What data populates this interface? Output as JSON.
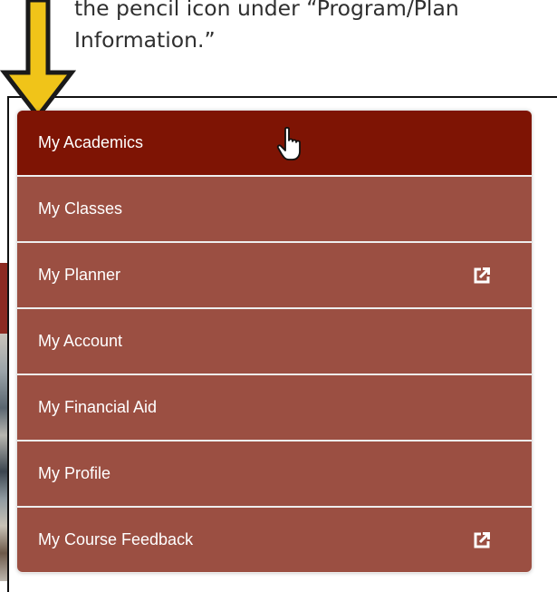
{
  "instruction": {
    "line1": "the pencil icon under “Program/Plan",
    "line2": "Information.”"
  },
  "colors": {
    "arrow_fill": "#f0c419",
    "menu_item": "#9b4f42",
    "menu_item_active": "#7e1404",
    "menu_text": "#ffffff"
  },
  "menu": {
    "items": [
      {
        "label": "My Academics",
        "active": true,
        "external_icon": "none"
      },
      {
        "label": "My Classes",
        "active": false,
        "external_icon": "none"
      },
      {
        "label": "My Planner",
        "active": false,
        "external_icon": "external-link-icon"
      },
      {
        "label": "My Account",
        "active": false,
        "external_icon": "none"
      },
      {
        "label": "My Financial Aid",
        "active": false,
        "external_icon": "none"
      },
      {
        "label": "My Profile",
        "active": false,
        "external_icon": "none"
      },
      {
        "label": "My Course Feedback",
        "active": false,
        "external_icon": "external-link-icon"
      }
    ]
  },
  "cursor_icon": "hand-pointer-icon",
  "annotation_icon": "down-arrow-icon"
}
